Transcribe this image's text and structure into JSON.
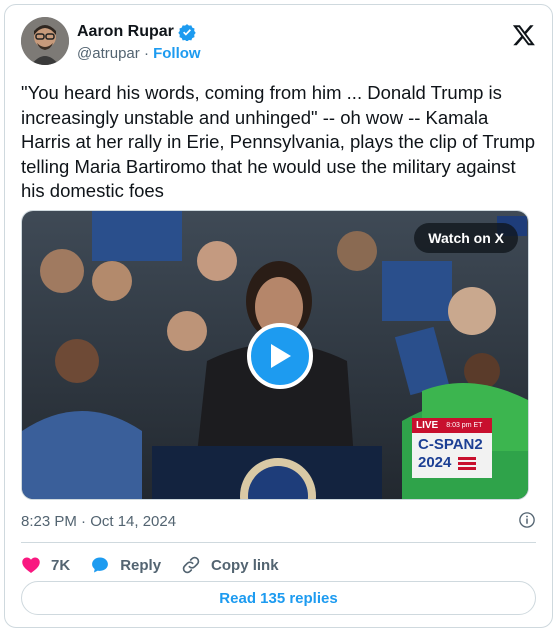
{
  "author": {
    "name": "Aaron Rupar",
    "handle": "@atrupar",
    "separator": "·",
    "follow_label": "Follow"
  },
  "tweet": {
    "text": "\"You heard his words, coming from him ... Donald Trump is increasingly unstable and unhinged\" -- oh wow -- Kamala Harris at her rally in Erie, Pennsylvania, plays the clip of Trump telling Maria Bartiromo that he would use the military against his domestic foes",
    "timestamp": "8:23 PM · Oct 14, 2024"
  },
  "media": {
    "watch_label": "Watch on X",
    "overlay": {
      "live": "LIVE",
      "time": "8:03 pm ET",
      "network": "C-SPAN2",
      "year": "2024"
    }
  },
  "actions": {
    "likes": "7K",
    "reply_label": "Reply",
    "copy_link_label": "Copy link"
  },
  "read_replies_label": "Read 135 replies",
  "colors": {
    "accent": "#1d9bf0",
    "like": "#f91880",
    "muted": "#536471",
    "border": "#cfd9de"
  },
  "icons": [
    "verified-badge-icon",
    "x-logo-icon",
    "play-icon",
    "info-icon",
    "heart-icon",
    "reply-bubble-icon",
    "link-icon"
  ]
}
